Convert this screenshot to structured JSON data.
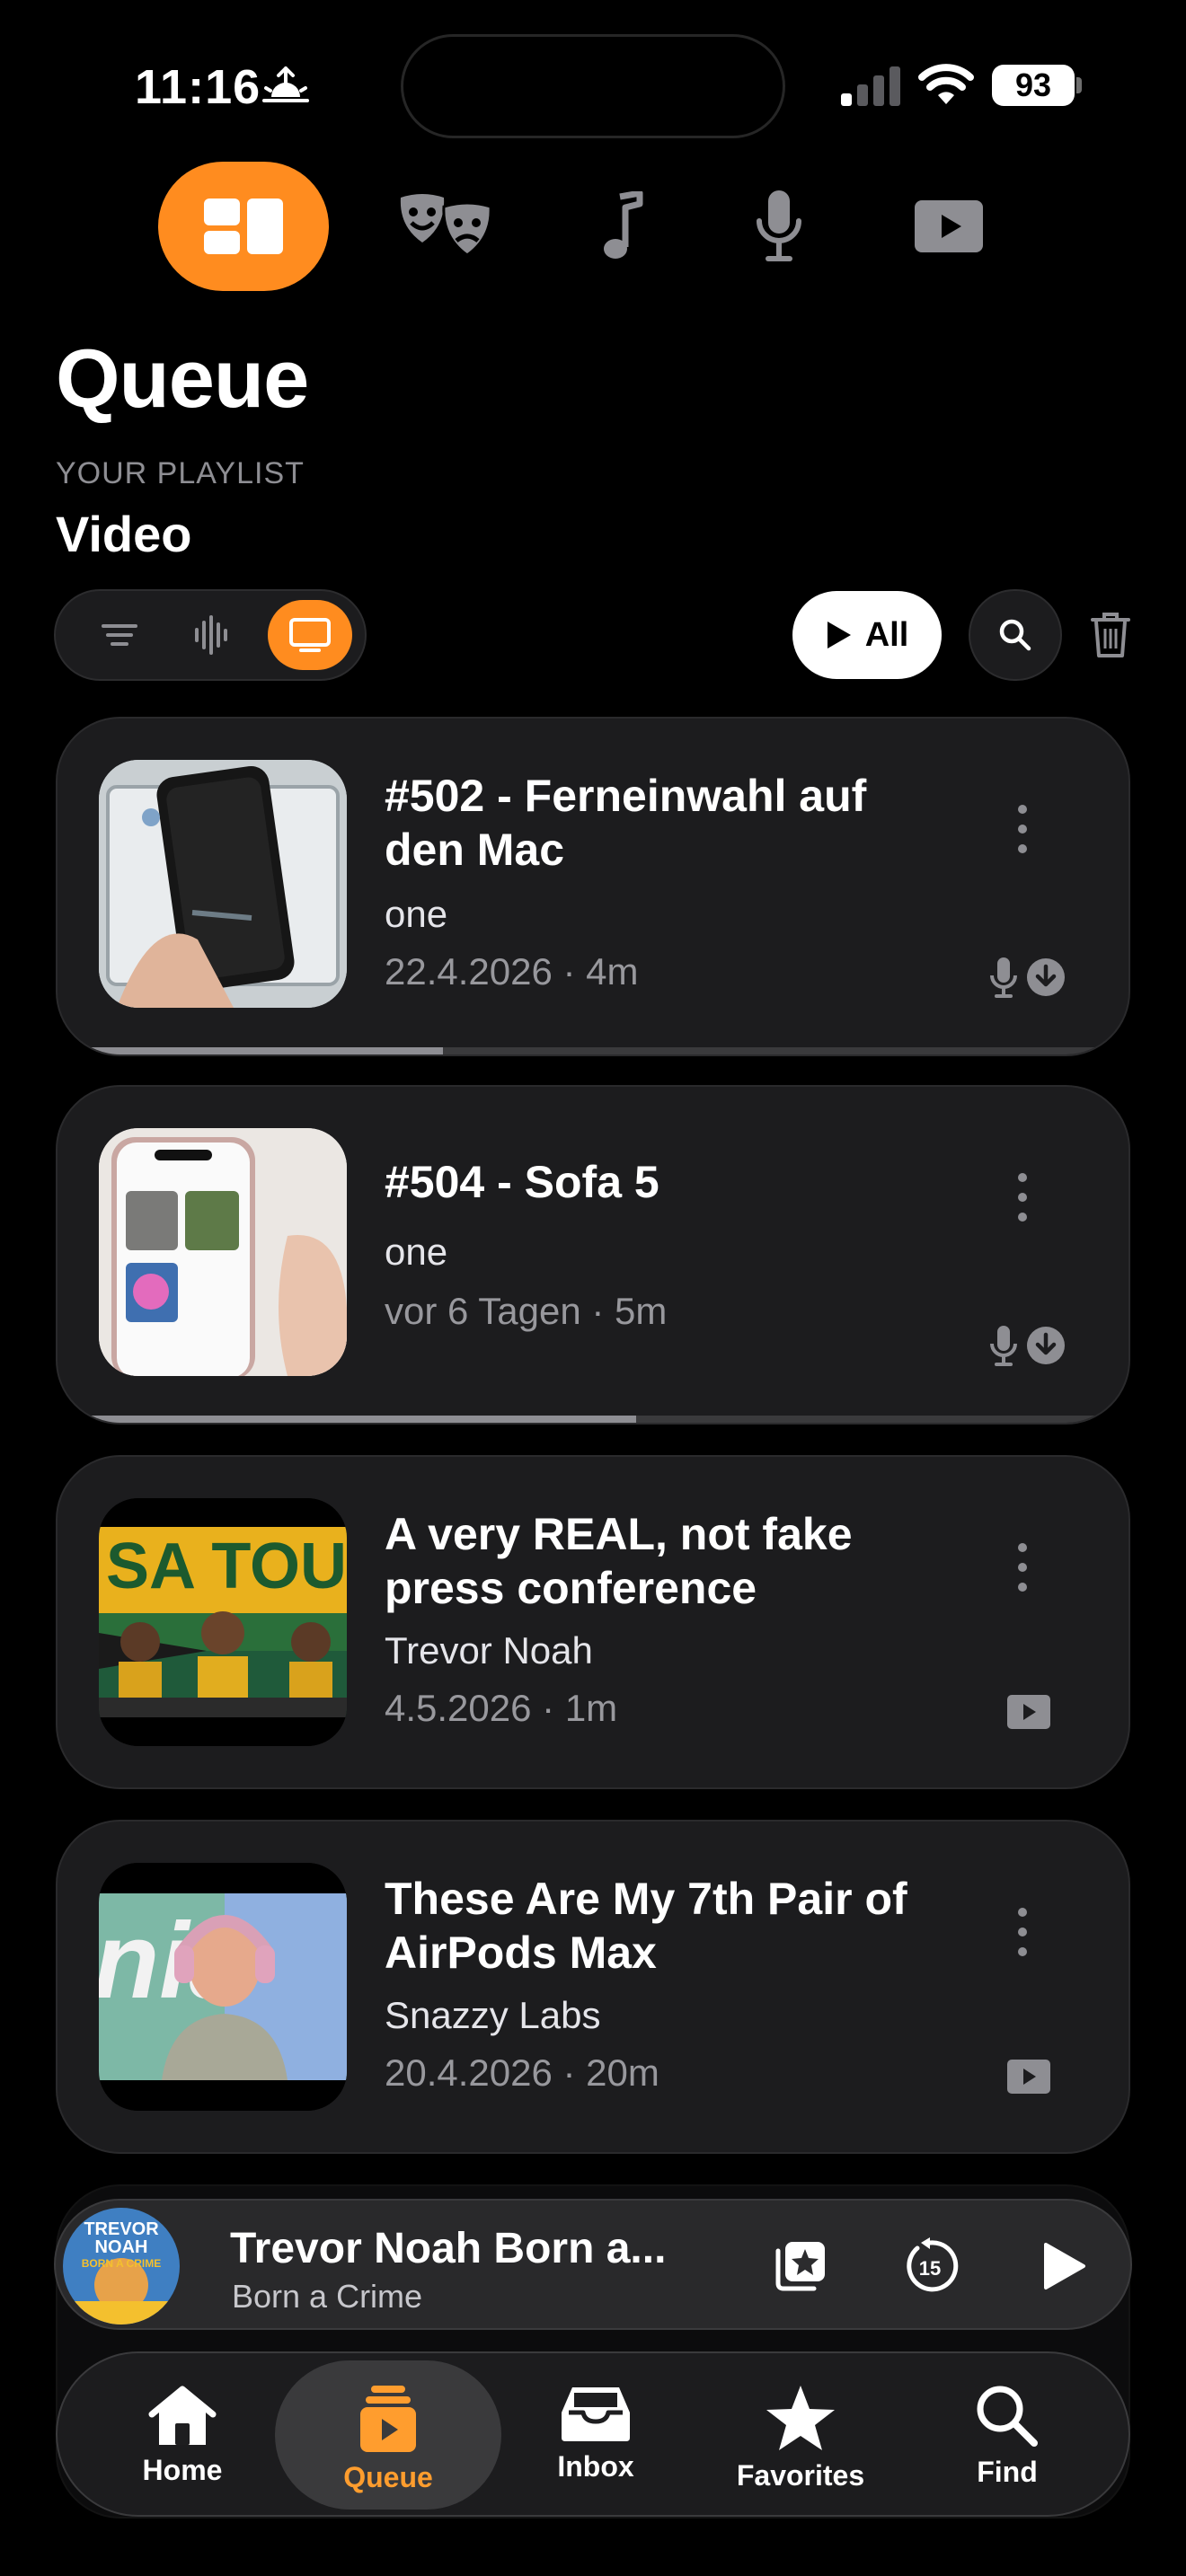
{
  "status_bar": {
    "time": "11:16",
    "battery": "93"
  },
  "library_tabs": [
    {
      "icon": "widgets-icon",
      "active": true
    },
    {
      "icon": "theater-masks-icon",
      "active": false
    },
    {
      "icon": "music-note-icon",
      "active": false
    },
    {
      "icon": "microphone-icon",
      "active": false
    },
    {
      "icon": "play-rectangle-icon",
      "active": false
    }
  ],
  "header": {
    "title": "Queue",
    "caption": "YOUR PLAYLIST",
    "playlist": "Video"
  },
  "filters": {
    "active": "video",
    "play_all_label": "All"
  },
  "episodes": [
    {
      "title": "#502 - Ferneinwahl auf den Mac",
      "author": "one",
      "meta": "22.4.2026 · 4m",
      "type": "podcast",
      "downloaded": true,
      "progress": 0.36
    },
    {
      "title": "#504 - Sofa 5",
      "author": "one",
      "meta": "vor 6 Tagen · 5m",
      "type": "podcast",
      "downloaded": true,
      "progress": 0.54
    },
    {
      "title": "A very REAL, not fake press conference",
      "author": "Trevor Noah",
      "meta": "4.5.2026 · 1m",
      "type": "video",
      "downloaded": false,
      "thumb_text": "SA TOUR"
    },
    {
      "title": "These Are My 7th Pair of AirPods Max",
      "author": "Snazzy Labs",
      "meta": "20.4.2026 · 20m",
      "type": "video",
      "downloaded": false,
      "thumb_text": "nia"
    }
  ],
  "now_playing": {
    "title": "Trevor Noah   Born a...",
    "subtitle": "Born a Crime",
    "art_text_1": "TREVOR",
    "art_text_2": "NOAH",
    "art_text_3": "BORN A CRIME",
    "skip_seconds": "15"
  },
  "tab_bar": [
    {
      "label": "Home",
      "icon": "house-icon",
      "active": false
    },
    {
      "label": "Queue",
      "icon": "queue-icon",
      "active": true
    },
    {
      "label": "Inbox",
      "icon": "inbox-tray-icon",
      "active": false
    },
    {
      "label": "Favorites",
      "icon": "star-icon",
      "active": false
    },
    {
      "label": "Find",
      "icon": "magnifier-icon",
      "active": false
    }
  ],
  "colors": {
    "accent": "#ff8c1f",
    "card": "#1c1c1e",
    "secondary_text": "#98989d"
  }
}
